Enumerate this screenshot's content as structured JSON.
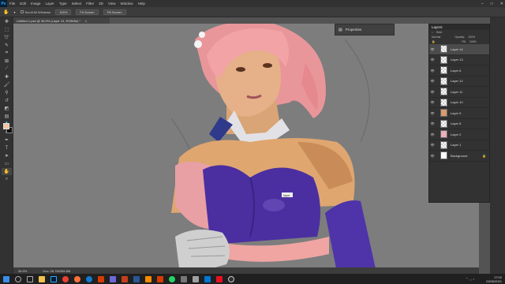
{
  "menubar": {
    "logo": "Ps",
    "items": [
      "File",
      "Edit",
      "Image",
      "Layer",
      "Type",
      "Select",
      "Filter",
      "3D",
      "View",
      "Window",
      "Help"
    ],
    "window_controls": [
      "–",
      "□",
      "✕"
    ]
  },
  "options": {
    "scroll_all": "Scroll All Windows",
    "zoom": "100%",
    "fit_screen": "Fit Screen",
    "fill_screen": "Fill Screen"
  },
  "document": {
    "tab_title": "Untitled-1.psd @ 36.9% (Layer 14, RGB/8#) *",
    "tab_close": "×",
    "cursor_label": "layer"
  },
  "properties": {
    "title": "Properties"
  },
  "layers_panel": {
    "title": "Layers",
    "kind": "Kind",
    "blend": "Normal",
    "opacity_label": "Opacity:",
    "opacity": "100%",
    "fill_label": "Fill:",
    "fill": "100%",
    "items": [
      {
        "name": "Layer 14"
      },
      {
        "name": "Layer 13"
      },
      {
        "name": "Layer 6"
      },
      {
        "name": "Layer 12"
      },
      {
        "name": "Layer 11"
      },
      {
        "name": "Layer 10"
      },
      {
        "name": "Layer 9"
      },
      {
        "name": "Layer 8"
      },
      {
        "name": "Layer 2"
      },
      {
        "name": "Layer 1"
      },
      {
        "name": "Background"
      }
    ]
  },
  "status": {
    "zoom": "36.9%",
    "doc": "Doc: 26.7M/306.6M"
  },
  "taskbar": {
    "time": "17:02",
    "date": "23/06/2021"
  },
  "colors": {
    "foreground": "#f2c4a0",
    "background": "#111111",
    "accent": "#31a8ff"
  }
}
